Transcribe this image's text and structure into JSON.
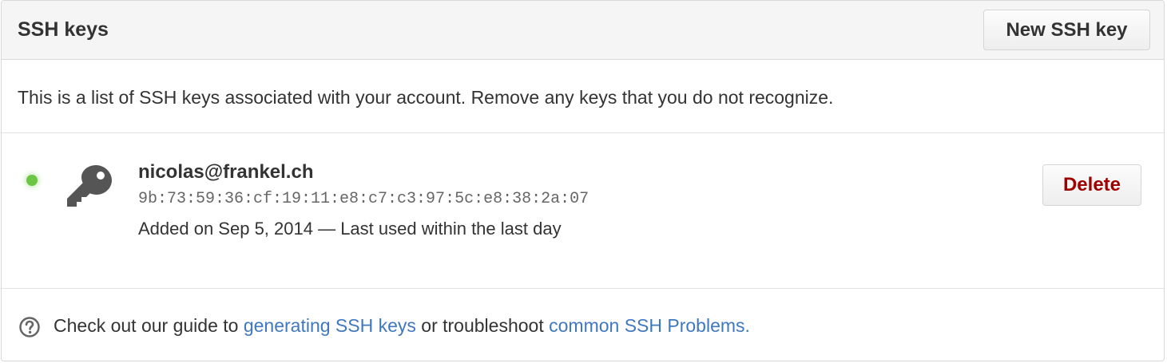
{
  "header": {
    "title": "SSH keys",
    "new_key_label": "New SSH key"
  },
  "intro": {
    "text": "This is a list of SSH keys associated with your account. Remove any keys that you do not recognize."
  },
  "keys": [
    {
      "title": "nicolas@frankel.ch",
      "fingerprint": "9b:73:59:36:cf:19:11:e8:c7:c3:97:5c:e8:38:2a:07",
      "meta": "Added on Sep 5, 2014 — Last used within the last day",
      "status": "active",
      "status_color": "#6cc644",
      "icon": "key-icon",
      "delete_label": "Delete"
    }
  ],
  "footer": {
    "icon": "question-icon",
    "text_before": "Check out our guide to ",
    "link1": "generating SSH keys",
    "text_middle": " or troubleshoot ",
    "link2": "common SSH Problems",
    "text_after": "."
  },
  "colors": {
    "link": "#4078c0",
    "danger": "#a00000",
    "header_bg": "#f5f5f5"
  }
}
